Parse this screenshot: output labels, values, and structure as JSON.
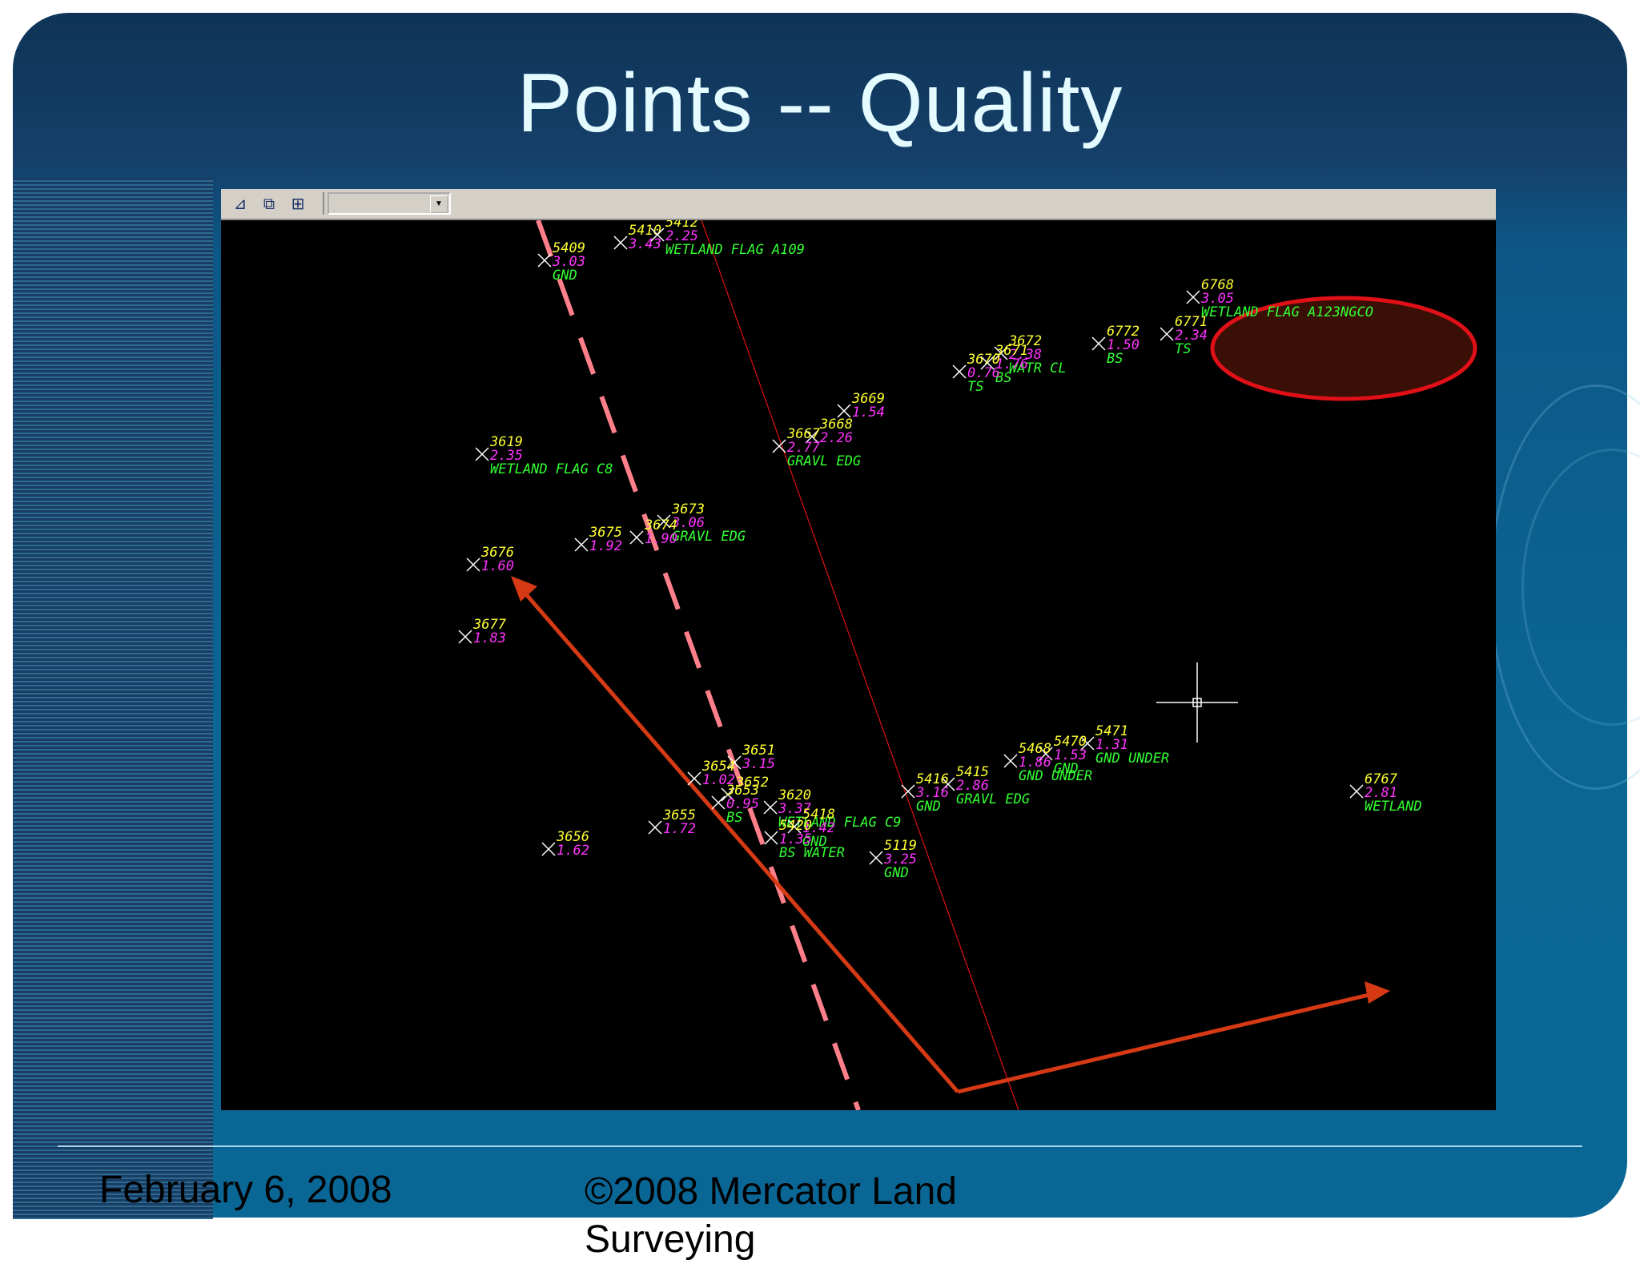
{
  "slide": {
    "title": "Points --  Quality",
    "footer_date": "February 6, 2008",
    "footer_copyright": "©2008 Mercator Land Surveying"
  },
  "toolbar": {
    "icons": [
      "dock-left-icon",
      "layer-swap-icon",
      "layer-tools-icon"
    ],
    "dropdown_value": ""
  },
  "colors": {
    "point_number": "#ffff33",
    "elevation": "#ff33ff",
    "description": "#33ff33",
    "dashed_line": "#ff7f8a",
    "thin_line": "#d01010",
    "arrow": "#d63a14",
    "highlight_ellipse": "#e01018",
    "highlight_fill": "#3a0f05"
  },
  "points": [
    {
      "num": "5410",
      "elev": "3.43",
      "desc": ""
    },
    {
      "num": "5409",
      "elev": "3.03",
      "desc": "GND"
    },
    {
      "num": "5412",
      "elev": "2.25",
      "desc": "WETLAND FLAG A109"
    },
    {
      "num": "3672",
      "elev": "2.38",
      "desc": "WATR CL"
    },
    {
      "num": "3671",
      "elev": "1.76",
      "desc": "BS"
    },
    {
      "num": "3670",
      "elev": "0.76",
      "desc": "TS"
    },
    {
      "num": "6771",
      "elev": "2.34",
      "desc": "TS"
    },
    {
      "num": "6772",
      "elev": "1.50",
      "desc": "BS"
    },
    {
      "num": "6768",
      "elev": "3.05",
      "desc": "WETLAND FLAG A123NGCO"
    },
    {
      "num": "3669",
      "elev": "1.54",
      "desc": ""
    },
    {
      "num": "3668",
      "elev": "2.26",
      "desc": ""
    },
    {
      "num": "3667",
      "elev": "2.77",
      "desc": "GRAVL EDG"
    },
    {
      "num": "3619",
      "elev": "2.35",
      "desc": "WETLAND FLAG C8"
    },
    {
      "num": "3673",
      "elev": "3.06",
      "desc": "GRAVL EDG"
    },
    {
      "num": "3674",
      "elev": "1.90",
      "desc": ""
    },
    {
      "num": "3675",
      "elev": "1.92",
      "desc": ""
    },
    {
      "num": "3676",
      "elev": "1.60",
      "desc": ""
    },
    {
      "num": "3677",
      "elev": "1.83",
      "desc": ""
    },
    {
      "num": "5471",
      "elev": "1.31",
      "desc": "GND UNDER"
    },
    {
      "num": "5470",
      "elev": "1.53",
      "desc": "GND"
    },
    {
      "num": "5468",
      "elev": "1.86",
      "desc": "GND UNDER"
    },
    {
      "num": "5415",
      "elev": "2.86",
      "desc": "GRAVL EDG"
    },
    {
      "num": "5416",
      "elev": "3.16",
      "desc": "GND"
    },
    {
      "num": "3651",
      "elev": "3.15",
      "desc": ""
    },
    {
      "num": "3654",
      "elev": "1.02",
      "desc": ""
    },
    {
      "num": "3652",
      "elev": "",
      "desc": ""
    },
    {
      "num": "3653",
      "elev": "0.95",
      "desc": "BS"
    },
    {
      "num": "3620",
      "elev": "3.37",
      "desc": "WETLAND FLAG C9"
    },
    {
      "num": "5418",
      "elev": "1.42",
      "desc": "GND"
    },
    {
      "num": "5420",
      "elev": "1.35",
      "desc": "BS WATER"
    },
    {
      "num": "3655",
      "elev": "1.72",
      "desc": ""
    },
    {
      "num": "3656",
      "elev": "1.62",
      "desc": ""
    },
    {
      "num": "5119",
      "elev": "3.25",
      "desc": "GND"
    },
    {
      "num": "6767",
      "elev": "2.81",
      "desc": "WETLAND"
    }
  ]
}
